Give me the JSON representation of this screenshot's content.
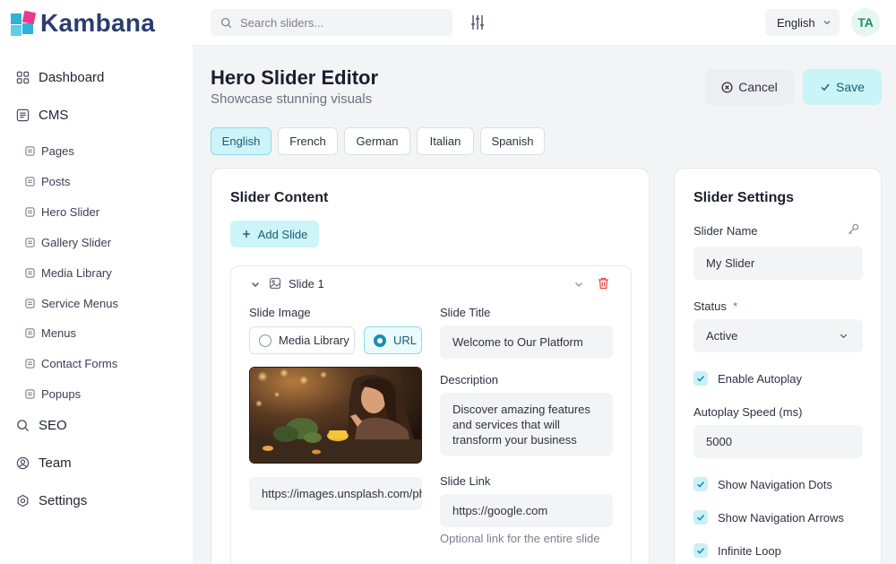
{
  "brand": {
    "name": "Kambana"
  },
  "sidebar": {
    "items": [
      {
        "label": "Dashboard",
        "icon": "dashboard-icon"
      },
      {
        "label": "CMS",
        "icon": "cms-icon"
      }
    ],
    "cms_children": [
      {
        "label": "Pages"
      },
      {
        "label": "Posts"
      },
      {
        "label": "Hero Slider"
      },
      {
        "label": "Gallery Slider"
      },
      {
        "label": "Media Library"
      },
      {
        "label": "Service Menus"
      },
      {
        "label": "Menus"
      },
      {
        "label": "Contact Forms"
      },
      {
        "label": "Popups"
      }
    ],
    "bottom_items": [
      {
        "label": "SEO",
        "icon": "search-icon"
      },
      {
        "label": "Team",
        "icon": "user-circle-icon"
      },
      {
        "label": "Settings",
        "icon": "gear-icon"
      }
    ]
  },
  "topbar": {
    "search_placeholder": "Search sliders...",
    "language": "English",
    "avatar_initials": "TA"
  },
  "header": {
    "title": "Hero Slider Editor",
    "subtitle": "Showcase stunning visuals",
    "cancel_label": "Cancel",
    "save_label": "Save"
  },
  "language_tabs": [
    {
      "label": "English",
      "active": true
    },
    {
      "label": "French",
      "active": false
    },
    {
      "label": "German",
      "active": false
    },
    {
      "label": "Italian",
      "active": false
    },
    {
      "label": "Spanish",
      "active": false
    }
  ],
  "content": {
    "title": "Slider Content",
    "add_slide_label": "Add Slide",
    "slide": {
      "name": "Slide 1",
      "image_label": "Slide Image",
      "source_options": [
        {
          "label": "Media Library",
          "selected": false
        },
        {
          "label": "URL",
          "selected": true
        }
      ],
      "image_url": "https://images.unsplash.com/photo",
      "title_label": "Slide Title",
      "title_value": "Welcome to Our Platform",
      "description_label": "Description",
      "description_value": "Discover amazing features and services that will transform your business",
      "link_label": "Slide Link",
      "link_value": "https://google.com",
      "link_hint": "Optional link for the entire slide"
    }
  },
  "settings": {
    "title": "Slider Settings",
    "name_label": "Slider Name",
    "name_value": "My Slider",
    "status_label": "Status",
    "status_required_mark": "*",
    "status_value": "Active",
    "autoplay_label": "Enable Autoplay",
    "autoplay_checked": true,
    "speed_label": "Autoplay Speed (ms)",
    "speed_value": "5000",
    "dots_label": "Show Navigation Dots",
    "dots_checked": true,
    "arrows_label": "Show Navigation Arrows",
    "arrows_checked": true,
    "loop_label": "Infinite Loop",
    "loop_checked": true
  },
  "colors": {
    "accent_bg": "#cdf4f8",
    "accent_text": "#1b5e72",
    "brand_text": "#2a3d6e",
    "delete": "#e04848"
  }
}
